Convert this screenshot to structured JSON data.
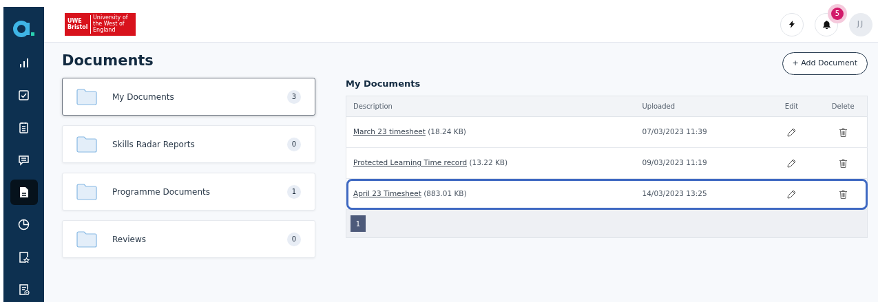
{
  "logo": {
    "name": "UWE Bristol",
    "subtitle": "University of the West of England"
  },
  "header": {
    "notifications": "5",
    "avatar": "JJ"
  },
  "sidebar": {
    "items": [
      {
        "selected": false
      },
      {
        "selected": false
      },
      {
        "selected": false
      },
      {
        "selected": false
      },
      {
        "selected": true
      },
      {
        "selected": false
      },
      {
        "selected": false
      },
      {
        "selected": false
      }
    ]
  },
  "page_title": "Documents",
  "folders": [
    {
      "label": "My Documents",
      "count": "3",
      "selected": true
    },
    {
      "label": "Skills Radar Reports",
      "count": "0",
      "selected": false
    },
    {
      "label": "Programme Documents",
      "count": "1",
      "selected": false
    },
    {
      "label": "Reviews",
      "count": "0",
      "selected": false
    }
  ],
  "add_button": "+ Add Document",
  "panel_title": "My Documents",
  "table": {
    "columns": [
      "Description",
      "Uploaded",
      "Edit",
      "Delete"
    ],
    "rows": [
      {
        "name": "March 23 timesheet",
        "size": "(18.24 KB)",
        "uploaded": "07/03/2023 11:39",
        "highlighted": false
      },
      {
        "name": "Protected Learning Time record",
        "size": "(13.22 KB)",
        "uploaded": "09/03/2023 11:19",
        "highlighted": false
      },
      {
        "name": "April 23 Timesheet",
        "size": "(883.01 KB)",
        "uploaded": "14/03/2023 13:25",
        "highlighted": true
      }
    ]
  },
  "pagination": [
    {
      "label": "1",
      "selected": true
    }
  ]
}
